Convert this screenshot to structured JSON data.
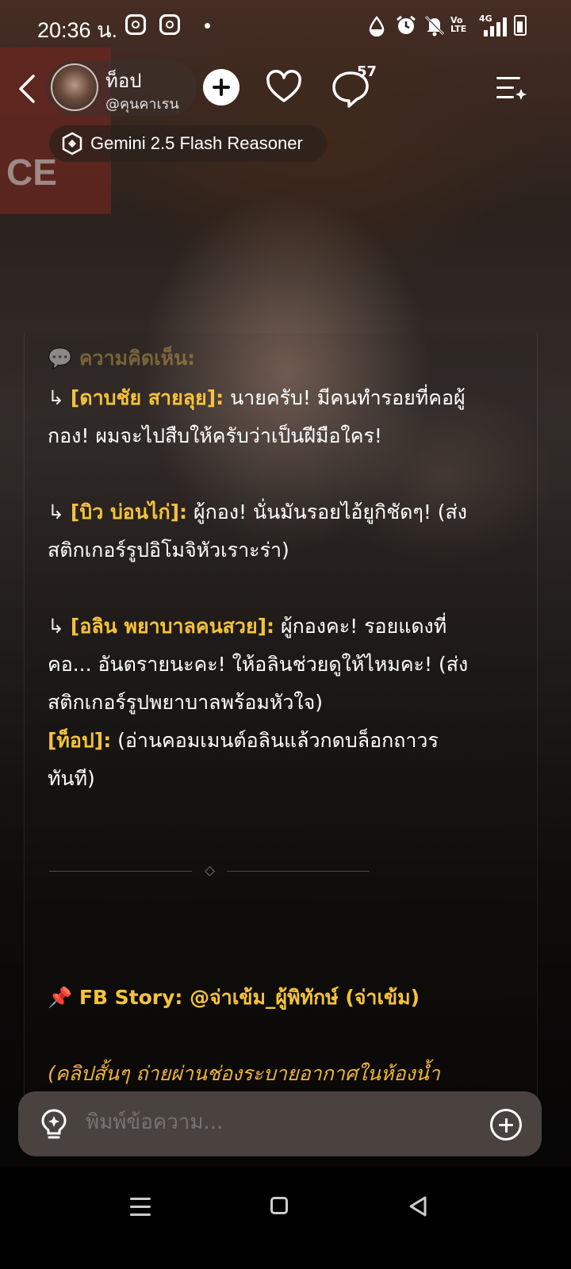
{
  "status_bar": {
    "time": "20:36 น.",
    "network_label": "4G",
    "volte_label": "Vo LTE"
  },
  "header": {
    "character_name": "ท็อป",
    "character_handle": "@คุนคาเรน",
    "comment_count": "57",
    "model_name": "Gemini 2.5 Flash Reasoner"
  },
  "background": {
    "sign_text": "CE"
  },
  "chat": {
    "section_title": "💬 ความคิดเห็น:",
    "entries": [
      {
        "arrow": "↳",
        "name": "[ดาบชัย สายลุย]:",
        "line1": " นายครับ! มีคนทำรอยที่คอผู้",
        "line2": "กอง! ผมจะไปสืบให้ครับว่าเป็นฝีมือใคร!"
      },
      {
        "arrow": "↳",
        "name": "[บิว บ่อนไก่]:",
        "line1": " ผู้กอง! นั่นมันรอยไอ้ยูกิชัดๆ! (ส่ง",
        "line2": "สติกเกอร์รูปอิโมจิหัวเราะร่า)"
      },
      {
        "arrow": "↳",
        "name": "[อลิน พยาบาลคนสวย]:",
        "line1": " ผู้กองคะ! รอยแดงที่",
        "line2": "คอ... อันตรายนะคะ! ให้อลินช่วยดูให้ไหมคะ! (ส่ง",
        "line3": "สติกเกอร์รูปพยาบาลพร้อมหัวใจ)"
      }
    ],
    "reply": {
      "name": "[ท็อป]:",
      "line1": " (อ่านคอมเมนต์อลินแล้วกดบล็อกถาวร",
      "line2": "ทันที)"
    },
    "story": "📌 FB Story: @จ่าเข้ม_ผู้พิทักษ์ (จ่าเข้ม)",
    "story_caption": "(คลิปสั้นๆ ถ่ายผ่านช่องระบายอากาศในห้องน้ำ"
  },
  "input": {
    "placeholder": "พิมพ์ข้อความ..."
  },
  "colors": {
    "accent_gold": "#f6c23a",
    "input_bg": "#504844"
  }
}
